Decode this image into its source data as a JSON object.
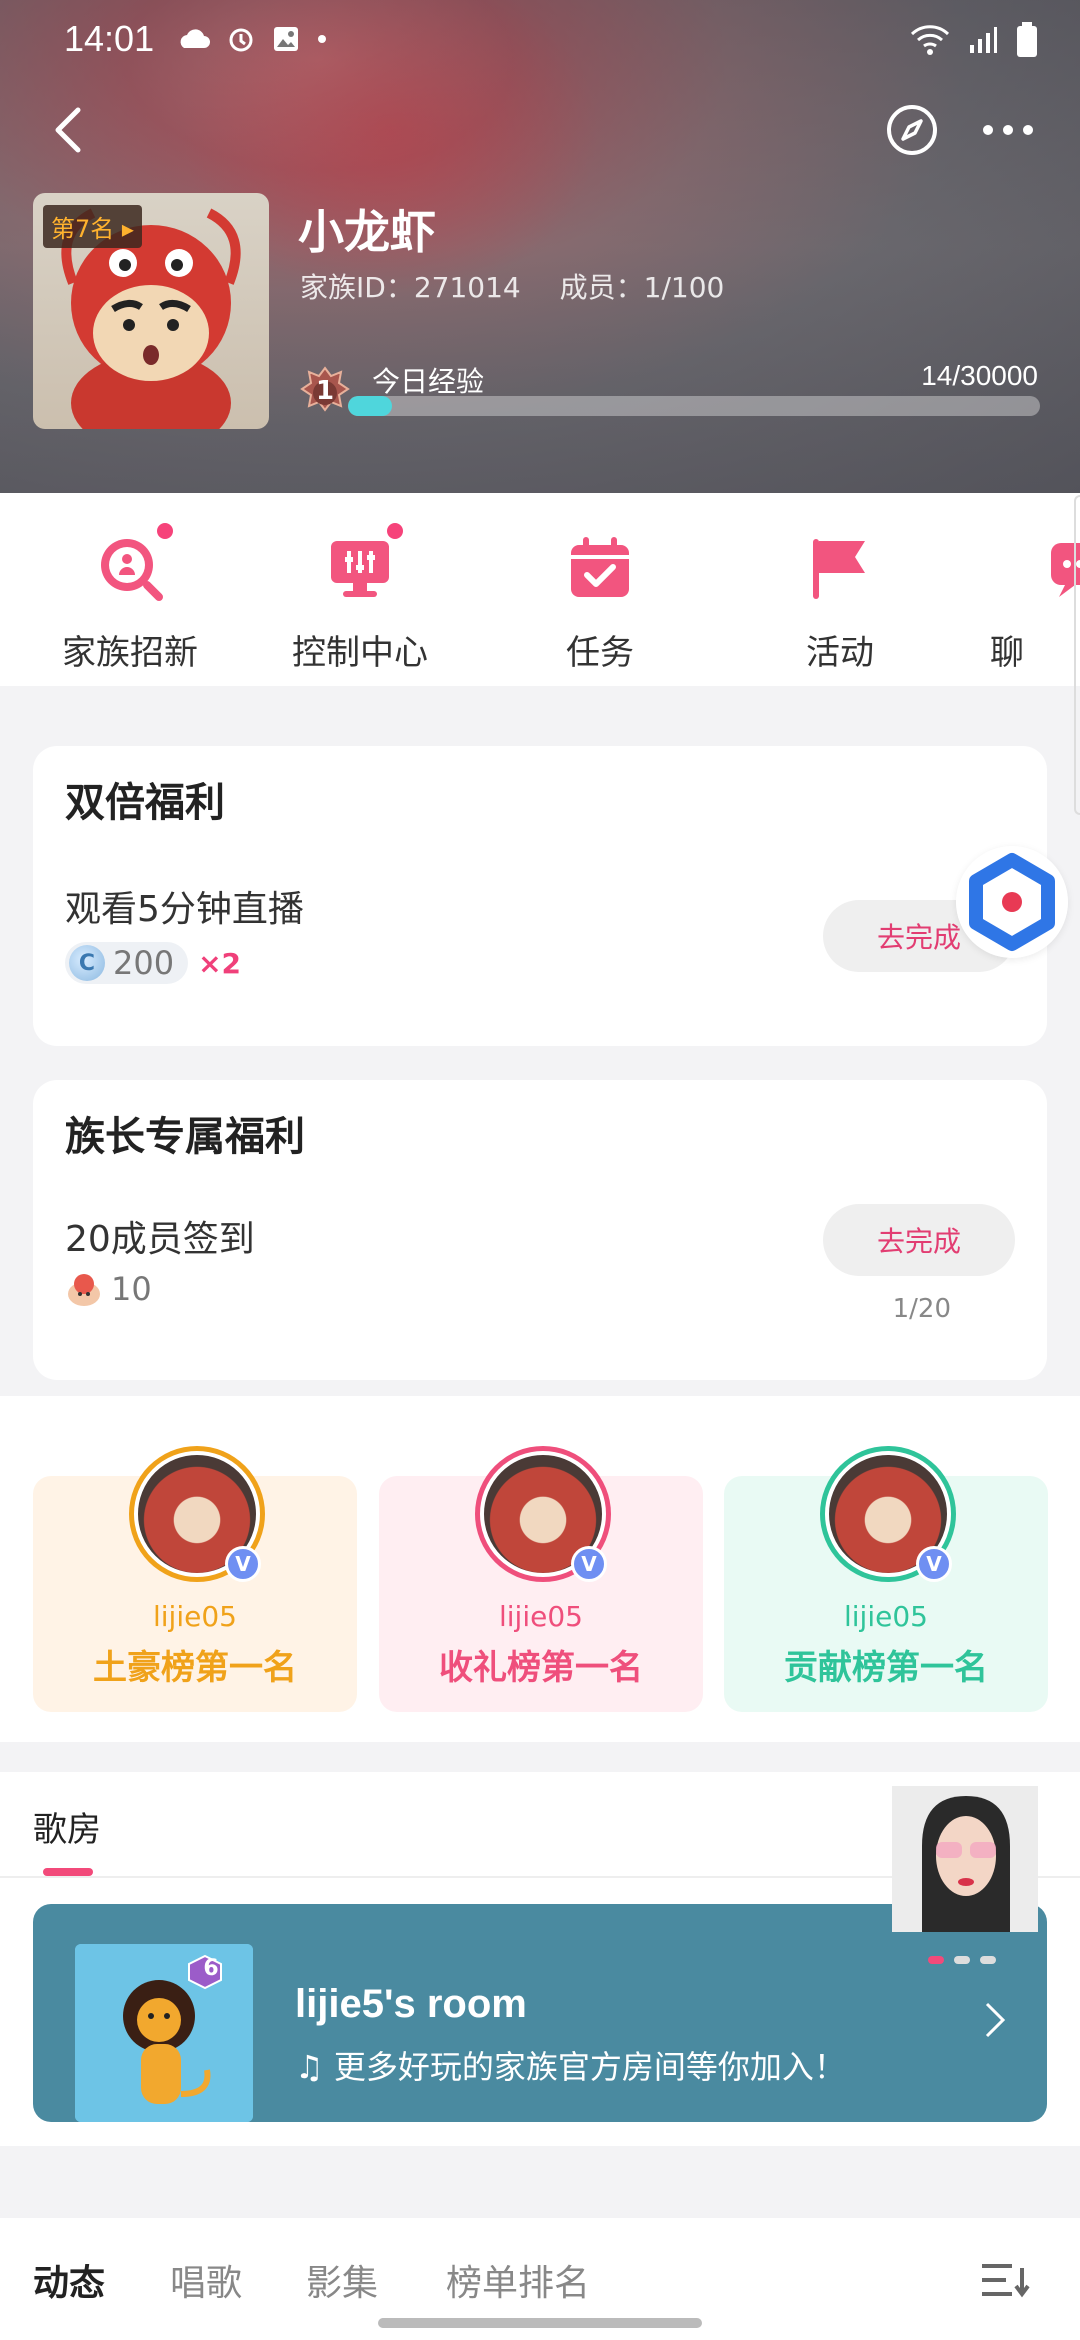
{
  "status_bar": {
    "time": "14:01"
  },
  "family": {
    "rank_badge": "第7名",
    "name": "小龙虾",
    "id_label": "家族ID：271014",
    "members_label": "成员：1/100",
    "level": "1",
    "exp_label": "今日经验",
    "exp_value": "14/30000",
    "exp_fraction": 0.0005
  },
  "shortcuts": [
    {
      "label": "家族招新",
      "icon": "recruit-icon",
      "dot": true
    },
    {
      "label": "控制中心",
      "icon": "control-center-icon",
      "dot": true
    },
    {
      "label": "任务",
      "icon": "calendar-task-icon",
      "dot": false
    },
    {
      "label": "活动",
      "icon": "flag-icon",
      "dot": false
    },
    {
      "label": "聊",
      "icon": "chat-icon",
      "dot": false
    }
  ],
  "double_bonus": {
    "title": "双倍福利",
    "task": "观看5分钟直播",
    "reward_amount": "200",
    "multiplier": "×2",
    "button": "去完成"
  },
  "leader_bonus": {
    "title": "族长专属福利",
    "task": "20成员签到",
    "reward_amount": "10",
    "button": "去完成",
    "progress": "1/20"
  },
  "top_three": [
    {
      "user": "lijie05",
      "title": "土豪榜第一名",
      "accent": "#f0a21a",
      "bg": "#fff3e6",
      "text": "#f0a21a"
    },
    {
      "user": "lijie05",
      "title": "收礼榜第一名",
      "accent": "#ef4f7c",
      "bg": "#ffeef2",
      "text": "#ef4f7c"
    },
    {
      "user": "lijie05",
      "title": "贡献榜第一名",
      "accent": "#2fc49a",
      "bg": "#e9faf4",
      "text": "#2fc49a"
    }
  ],
  "room_section": {
    "tab": "歌房",
    "room_title": "lijie5's room",
    "room_sub": "更多好玩的家族官方房间等你加入！",
    "room_badge": "6"
  },
  "bottom_tabs": [
    "动态",
    "唱歌",
    "影集",
    "榜单排名"
  ],
  "colors": {
    "accent": "#f24a7a",
    "room_card": "#4a8aa0"
  }
}
